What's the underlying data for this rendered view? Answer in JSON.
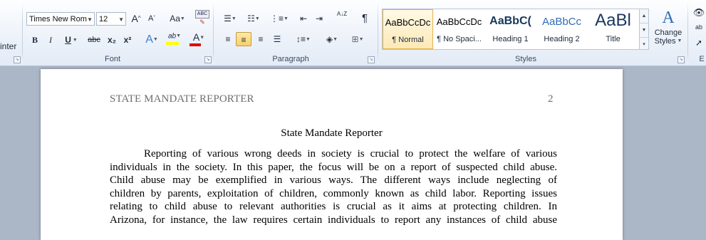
{
  "ribbon": {
    "clipboard": {
      "format_painter_label": "inter",
      "launcher": "↘"
    },
    "font": {
      "group_label": "Font",
      "font_name": "Times New Rom",
      "font_size": "12",
      "grow_font": "A",
      "shrink_font": "A",
      "change_case": "Aa",
      "clear_formatting": "ABC",
      "bold": "B",
      "italic": "I",
      "underline": "U",
      "strikethrough": "abc",
      "subscript": "x₂",
      "superscript": "x²",
      "text_effects": "A",
      "highlight": "ab",
      "font_color": "A",
      "launcher": "↘"
    },
    "paragraph": {
      "group_label": "Paragraph",
      "show_marks": "¶",
      "sort": "A↓Z",
      "launcher": "↘"
    },
    "styles": {
      "group_label": "Styles",
      "items": [
        {
          "sample": "AaBbCcDc",
          "name": "¶ Normal"
        },
        {
          "sample": "AaBbCcDc",
          "name": "¶ No Spaci..."
        },
        {
          "sample": "AaBbC(",
          "name": "Heading 1"
        },
        {
          "sample": "AaBbCc",
          "name": "Heading 2"
        },
        {
          "sample": "AaBl",
          "name": "Title"
        }
      ],
      "change_styles_label_1": "Change",
      "change_styles_label_2": "Styles",
      "launcher": "↘"
    },
    "editing": {
      "label": "E"
    },
    "colors": {
      "heading_blue": "#17365d",
      "accent_blue": "#2f6db5",
      "highlight_yellow": "#ffff00",
      "font_red": "#e00000"
    }
  },
  "document": {
    "header_title": "STATE MANDATE REPORTER",
    "header_page": "2",
    "title": "State Mandate Reporter",
    "lines": [
      "Reporting of various wrong deeds in society is crucial to protect the welfare of various",
      "individuals in the society. In this paper, the focus will be on a report of suspected child abuse.",
      "Child abuse may be exemplified in various ways. The different ways include neglecting of",
      "children by parents, exploitation of children, commonly known as child labor. Reporting issues",
      "relating to child abuse to relevant authorities is crucial as it aims at protecting children. In",
      "Arizona, for instance, the law requires certain individuals to report any instances of child abuse"
    ]
  }
}
